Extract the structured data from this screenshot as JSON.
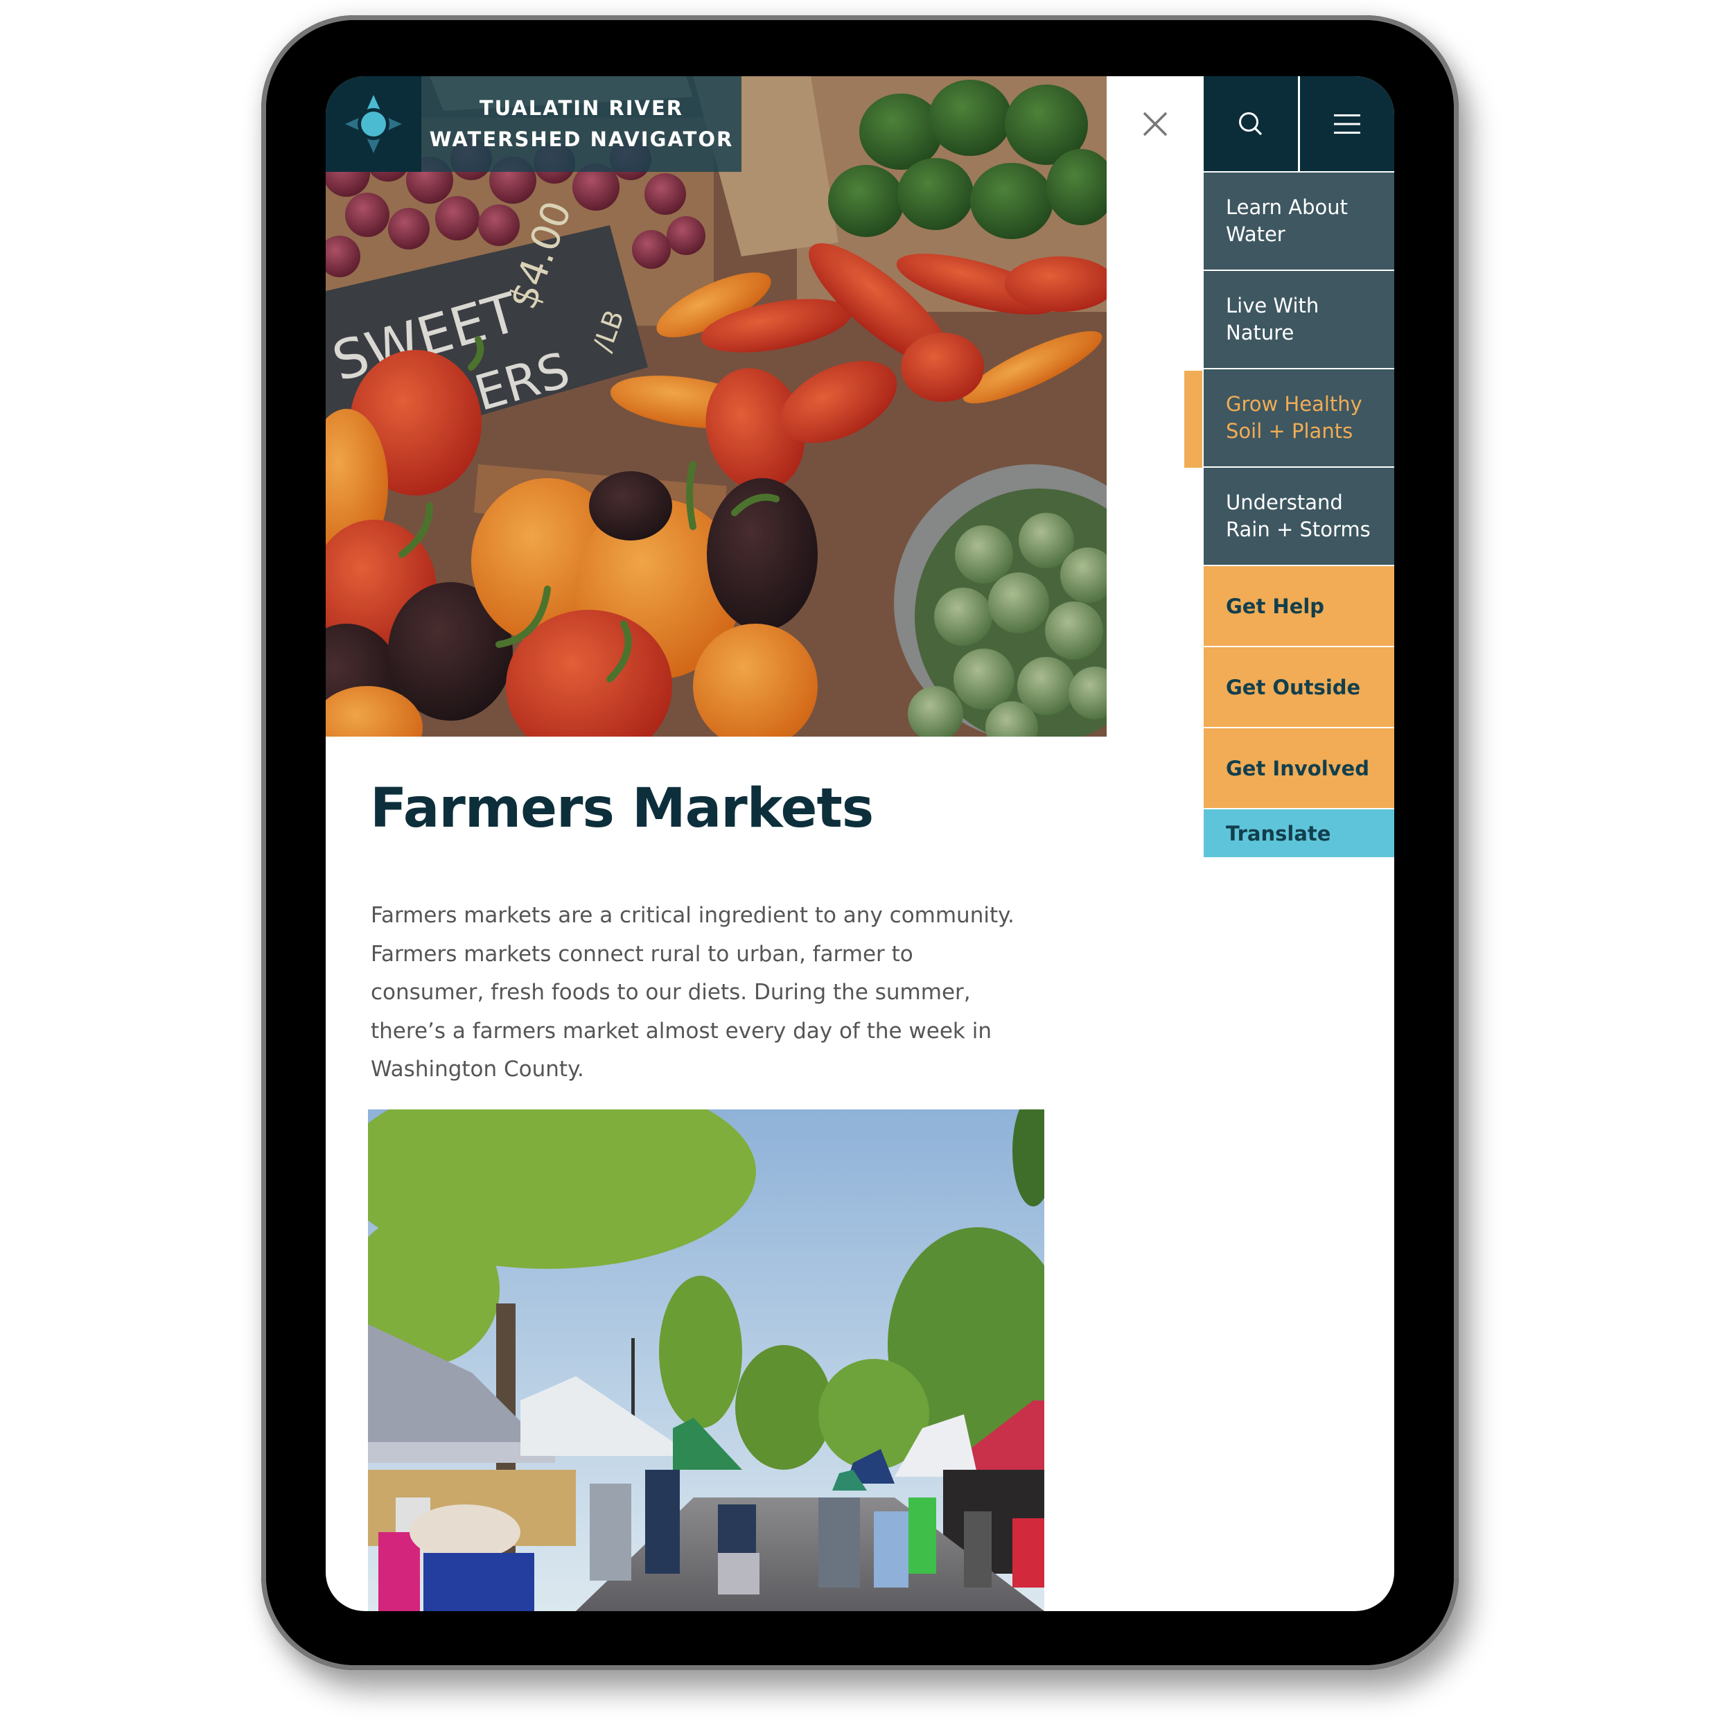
{
  "site": {
    "title_line1": "TUALATIN RIVER",
    "title_line2": "WATERSHED NAVIGATOR",
    "logo_icon": "compass-icon"
  },
  "header": {
    "close_icon": "close-icon",
    "search_icon": "search-icon",
    "menu_icon": "hamburger-menu-icon"
  },
  "menu": {
    "items": [
      {
        "line1": "Learn About",
        "line2": "Water",
        "active": false
      },
      {
        "line1": "Live With",
        "line2": "Nature",
        "active": false
      },
      {
        "line1": "Grow Healthy",
        "line2": "Soil + Plants",
        "active": true
      },
      {
        "line1": "Understand",
        "line2": "Rain + Storms",
        "active": false
      }
    ],
    "actions": [
      {
        "label": "Get Help"
      },
      {
        "label": "Get Outside"
      },
      {
        "label": "Get Involved"
      }
    ],
    "translate_label": "Translate"
  },
  "hero": {
    "alt": "Baskets of sweet peppers with chalkboard sign",
    "sign_line1": "SWEET",
    "sign_line2": "PEPPERS",
    "sign_price": "$4.00",
    "sign_unit": "/LB"
  },
  "article": {
    "title": "Farmers Markets",
    "body_lines": [
      "Farmers markets are a critical ingredient to any community.",
      "Farmers markets connect rural to urban, farmer to",
      "consumer, fresh foods to our diets. During the summer,",
      "there’s a farmers market almost every day of the week in",
      "Washington County."
    ],
    "image_alt": "Crowd walking between vendor tents at an outdoor farmers market"
  },
  "colors": {
    "brand_dark": "#0b2d3a",
    "menu_item": "#3e5761",
    "accent_orange": "#f1ac55",
    "accent_cyan": "#5ec4d9",
    "heading": "#0d2f3b",
    "body_text": "#555555"
  }
}
